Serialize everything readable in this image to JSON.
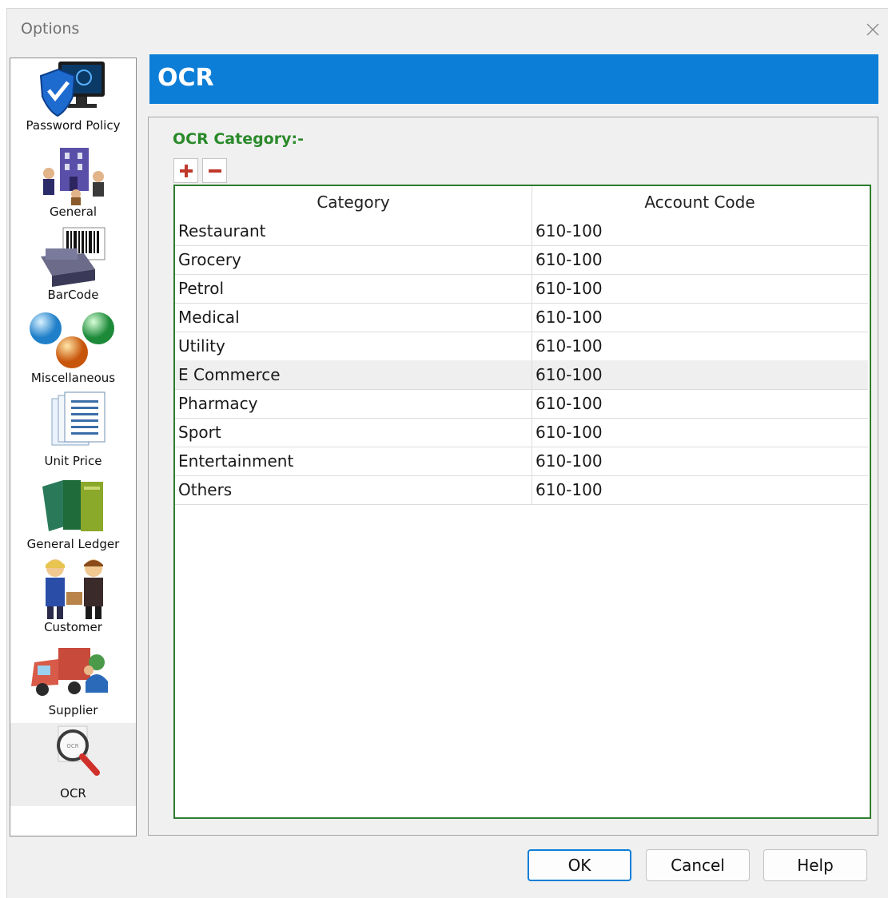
{
  "window": {
    "title": "Options"
  },
  "sidebar": {
    "items": [
      {
        "label": "Password Policy",
        "icon": "shield-monitor-icon"
      },
      {
        "label": "General",
        "icon": "building-people-icon"
      },
      {
        "label": "BarCode",
        "icon": "barcode-printer-icon"
      },
      {
        "label": "Miscellaneous",
        "icon": "spheres-icon"
      },
      {
        "label": "Unit Price",
        "icon": "documents-icon"
      },
      {
        "label": "General Ledger",
        "icon": "ledger-books-icon"
      },
      {
        "label": "Customer",
        "icon": "customer-people-icon"
      },
      {
        "label": "Supplier",
        "icon": "delivery-truck-icon"
      },
      {
        "label": "OCR",
        "icon": "ocr-magnifier-icon",
        "selected": true
      }
    ]
  },
  "header": {
    "title": "OCR"
  },
  "panel": {
    "category_label": "OCR Category:-",
    "grid": {
      "columns": [
        "Category",
        "Account Code"
      ],
      "rows": [
        {
          "category": "Restaurant",
          "account_code": "610-100"
        },
        {
          "category": "Grocery",
          "account_code": "610-100"
        },
        {
          "category": "Petrol",
          "account_code": "610-100"
        },
        {
          "category": "Medical",
          "account_code": "610-100"
        },
        {
          "category": "Utility",
          "account_code": "610-100"
        },
        {
          "category": "E Commerce",
          "account_code": "610-100"
        },
        {
          "category": "Pharmacy",
          "account_code": "610-100"
        },
        {
          "category": "Sport",
          "account_code": "610-100"
        },
        {
          "category": "Entertainment",
          "account_code": "610-100"
        },
        {
          "category": "Others",
          "account_code": "610-100"
        }
      ]
    }
  },
  "footer": {
    "ok_label": "OK",
    "cancel_label": "Cancel",
    "help_label": "Help"
  },
  "colors": {
    "header_bg": "#0d7ed7",
    "accent_green": "#2a8a2a",
    "grid_border": "#2d7d2d",
    "add_remove_red": "#c0392b"
  }
}
